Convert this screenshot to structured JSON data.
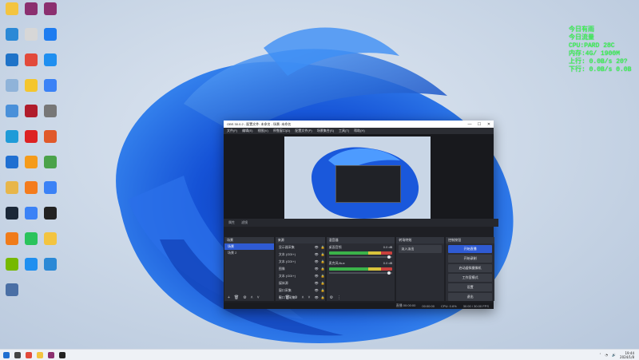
{
  "overlay": {
    "lines": [
      "今日有雨",
      "今日流量 ",
      "CPU:PARD 28C",
      "内存:4G/ 1900M",
      "上行: 0.0B/s 20?",
      "下行: 0.0B/s 0.0B"
    ]
  },
  "desktop": {
    "icons": [
      {
        "name": "folder-icon",
        "color": "#f3c440"
      },
      {
        "name": "winrar-icon",
        "color": "#8b2f6f"
      },
      {
        "name": "winrar-icon-2",
        "color": "#8b2f6f"
      },
      {
        "name": "monitor-icon",
        "color": "#2b89d6"
      },
      {
        "name": "app-icon",
        "color": "#d7d7d7"
      },
      {
        "name": "messenger-icon",
        "color": "#1e7cf0"
      },
      {
        "name": "setup-icon",
        "color": "#1f73c8"
      },
      {
        "name": "chrome-icon",
        "color": "#e24a3b"
      },
      {
        "name": "blue-app-icon",
        "color": "#1f8ff0"
      },
      {
        "name": "recycle-bin-icon",
        "color": "#8fb3d9"
      },
      {
        "name": "yellow-app-icon",
        "color": "#f4c62e"
      },
      {
        "name": "player-icon",
        "color": "#3b82f6"
      },
      {
        "name": "control-icon",
        "color": "#4a90d9"
      },
      {
        "name": "red-app-icon",
        "color": "#b01c2b"
      },
      {
        "name": "qr-icon",
        "color": "#777"
      },
      {
        "name": "edge-icon",
        "color": "#1f9bd8"
      },
      {
        "name": "netease-icon",
        "color": "#d22"
      },
      {
        "name": "calendar-icon",
        "color": "#e0592a"
      },
      {
        "name": "bag-icon",
        "color": "#1f6fd1"
      },
      {
        "name": "orange-app-icon",
        "color": "#f59b1a"
      },
      {
        "name": "earth-icon",
        "color": "#4aa24a"
      },
      {
        "name": "owl-icon",
        "color": "#e8b64a"
      },
      {
        "name": "orange-circle-icon",
        "color": "#f47c1d"
      },
      {
        "name": "play-icon",
        "color": "#3b82f6"
      },
      {
        "name": "steam-icon",
        "color": "#1b2838"
      },
      {
        "name": "play-icon-2",
        "color": "#3b82f6"
      },
      {
        "name": "obs-icon",
        "color": "#222"
      },
      {
        "name": "vlc-icon",
        "color": "#f07b1a"
      },
      {
        "name": "wechat-icon",
        "color": "#2ac35c"
      },
      {
        "name": "folder-icon-2",
        "color": "#f3c440"
      },
      {
        "name": "nvidia-icon",
        "color": "#76b900"
      },
      {
        "name": "cloud-icon",
        "color": "#1f8ff0"
      },
      {
        "name": "circle-app-icon",
        "color": "#2b89d6"
      },
      {
        "name": "mascot-icon",
        "color": "#4a6fa5"
      }
    ]
  },
  "obs": {
    "title": "OBS 30.0.2 - 配置文件: 未命名 - 场景: 未命名",
    "menu": [
      "文件(F)",
      "编辑(E)",
      "视图(V)",
      "停靠窗口(D)",
      "配置文件(P)",
      "场景集合(S)",
      "工具(T)",
      "帮助(H)"
    ],
    "ph_bar": [
      "属性",
      "滤镜"
    ],
    "panes": {
      "scenes": {
        "title": "场景",
        "items": [
          "场景",
          "场景 2"
        ]
      },
      "sources": {
        "title": "来源",
        "items": [
          "显示器采集",
          "文本 (GDI+)",
          "文本 (GDI+)",
          "图像",
          "文本 (GDI+)",
          "媒体源",
          "窗口采集",
          "窗口 2 采集"
        ]
      },
      "mixer": {
        "title": "混音器",
        "channels": [
          {
            "name": "桌面音频",
            "db": "0.0 dB"
          },
          {
            "name": "麦克风/Aux",
            "db": "0.0 dB"
          }
        ]
      },
      "transitions": {
        "title": "转场特效",
        "value": "淡入淡出"
      },
      "controls": {
        "title": "控制按钮",
        "buttons": [
          "开始直播",
          "开始录制",
          "启动虚拟摄像机",
          "工作室模式",
          "设置",
          "退出"
        ]
      }
    },
    "status": [
      "直播 00:00:00",
      "00:00:00",
      "CPU: 0.6%",
      "30.00 / 30.00 FPS"
    ]
  },
  "taskbar": {
    "time": "19:44",
    "date": "2024/1/8",
    "icons": [
      {
        "name": "start-icon",
        "color": "#1f6fd1"
      },
      {
        "name": "search-icon",
        "color": "#444"
      },
      {
        "name": "chrome-taskbar-icon",
        "color": "#e24a3b"
      },
      {
        "name": "explorer-icon",
        "color": "#f3c440"
      },
      {
        "name": "app-taskbar-icon",
        "color": "#8b2f6f"
      },
      {
        "name": "obs-taskbar-icon",
        "color": "#222"
      }
    ]
  }
}
